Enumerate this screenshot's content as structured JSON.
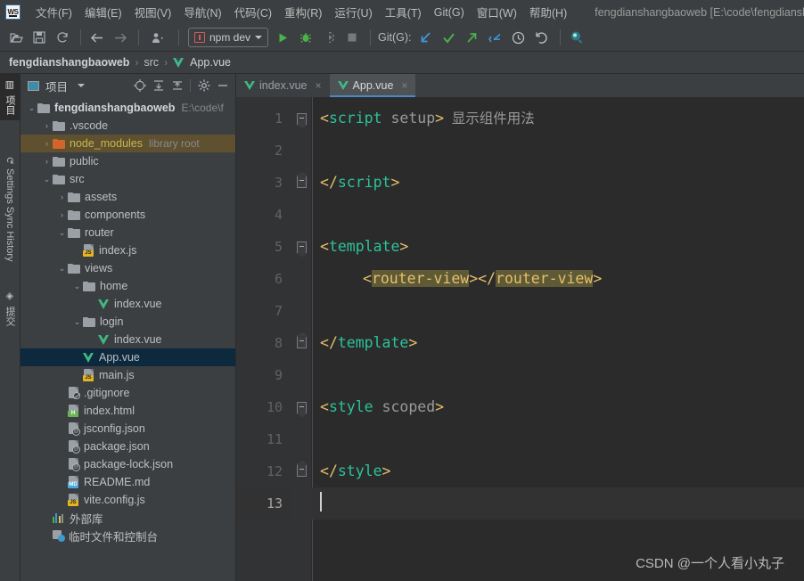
{
  "window": {
    "app_icon": "webstorm-logo-icon",
    "project_path_title": "fengdianshangbaoweb [E:\\code\\fengdianshan"
  },
  "menu": {
    "items": [
      {
        "label": "文件(F)",
        "name": "menu-file"
      },
      {
        "label": "编辑(E)",
        "name": "menu-edit"
      },
      {
        "label": "视图(V)",
        "name": "menu-view"
      },
      {
        "label": "导航(N)",
        "name": "menu-navigate"
      },
      {
        "label": "代码(C)",
        "name": "menu-code"
      },
      {
        "label": "重构(R)",
        "name": "menu-refactor"
      },
      {
        "label": "运行(U)",
        "name": "menu-run"
      },
      {
        "label": "工具(T)",
        "name": "menu-tools"
      },
      {
        "label": "Git(G)",
        "name": "menu-git"
      },
      {
        "label": "窗口(W)",
        "name": "menu-window"
      },
      {
        "label": "帮助(H)",
        "name": "menu-help"
      }
    ]
  },
  "toolbar": {
    "open_icon": "open-folder-icon",
    "save_icon": "save-icon",
    "sync_icon": "refresh-icon",
    "back_icon": "arrow-left-icon",
    "forward_icon": "arrow-right-icon",
    "profile_icon": "user-dropdown-icon",
    "run_config": "npm dev",
    "run_icon": "run-play-icon",
    "debug_icon": "debug-bug-icon",
    "coverage_icon": "run-coverage-icon",
    "stop_icon": "stop-square-icon",
    "git_label": "Git(G):",
    "update_icon": "git-update-arrow-icon",
    "commit_icon": "git-commit-check-icon",
    "push_icon": "git-push-arrow-icon",
    "pull_icon": "git-pull-icon",
    "history_icon": "clock-history-icon",
    "rollback_icon": "rollback-undo-icon",
    "search_icon": "search-everywhere-icon"
  },
  "breadcrumb": {
    "root": "fengdianshangbaoweb",
    "sep": "›",
    "mid": "src",
    "leaf": "App.vue",
    "leaf_icon": "vue-file-icon"
  },
  "rail": {
    "project_label": "项目",
    "project_icon": "project-panel-icon",
    "sync_label": "Settings Sync History",
    "sync_icon": "sync-history-icon",
    "commit_label": "提交",
    "commit_icon": "commit-icon"
  },
  "project_panel": {
    "title": "项目",
    "title_icon": "project-view-icon",
    "dropdown_icon": "chevron-down-icon",
    "actions": [
      {
        "name": "locate-file-icon",
        "glyph": "⊕"
      },
      {
        "name": "expand-all-icon",
        "glyph": "⤓"
      },
      {
        "name": "collapse-all-icon",
        "glyph": "⤒"
      },
      {
        "name": "settings-gear-icon",
        "glyph": "⚙"
      },
      {
        "name": "hide-panel-icon",
        "glyph": "—"
      }
    ],
    "tree": [
      {
        "label": "fengdianshangbaoweb",
        "hint": "E:\\code\\f",
        "indent": 0,
        "arrow": "v",
        "icon": "folder",
        "style": "bold"
      },
      {
        "label": ".vscode",
        "hint": "",
        "indent": 1,
        "arrow": ">",
        "icon": "folder"
      },
      {
        "label": "node_modules",
        "hint": "library root",
        "indent": 1,
        "arrow": ">",
        "icon": "folder-orange",
        "style": "module",
        "state": "highlighted"
      },
      {
        "label": "public",
        "hint": "",
        "indent": 1,
        "arrow": ">",
        "icon": "folder"
      },
      {
        "label": "src",
        "hint": "",
        "indent": 1,
        "arrow": "v",
        "icon": "folder"
      },
      {
        "label": "assets",
        "hint": "",
        "indent": 2,
        "arrow": ">",
        "icon": "folder"
      },
      {
        "label": "components",
        "hint": "",
        "indent": 2,
        "arrow": ">",
        "icon": "folder"
      },
      {
        "label": "router",
        "hint": "",
        "indent": 2,
        "arrow": "v",
        "icon": "folder"
      },
      {
        "label": "index.js",
        "hint": "",
        "indent": 3,
        "arrow": "",
        "icon": "js"
      },
      {
        "label": "views",
        "hint": "",
        "indent": 2,
        "arrow": "v",
        "icon": "folder"
      },
      {
        "label": "home",
        "hint": "",
        "indent": 3,
        "arrow": "v",
        "icon": "folder"
      },
      {
        "label": "index.vue",
        "hint": "",
        "indent": 4,
        "arrow": "",
        "icon": "vue"
      },
      {
        "label": "login",
        "hint": "",
        "indent": 3,
        "arrow": "v",
        "icon": "folder"
      },
      {
        "label": "index.vue",
        "hint": "",
        "indent": 4,
        "arrow": "",
        "icon": "vue"
      },
      {
        "label": "App.vue",
        "hint": "",
        "indent": 3,
        "arrow": "",
        "icon": "vue",
        "state": "selected"
      },
      {
        "label": "main.js",
        "hint": "",
        "indent": 3,
        "arrow": "",
        "icon": "js"
      },
      {
        "label": ".gitignore",
        "hint": "",
        "indent": 2,
        "arrow": "",
        "icon": "gitignore"
      },
      {
        "label": "index.html",
        "hint": "",
        "indent": 2,
        "arrow": "",
        "icon": "html"
      },
      {
        "label": "jsconfig.json",
        "hint": "",
        "indent": 2,
        "arrow": "",
        "icon": "json"
      },
      {
        "label": "package.json",
        "hint": "",
        "indent": 2,
        "arrow": "",
        "icon": "json"
      },
      {
        "label": "package-lock.json",
        "hint": "",
        "indent": 2,
        "arrow": "",
        "icon": "json"
      },
      {
        "label": "README.md",
        "hint": "",
        "indent": 2,
        "arrow": "",
        "icon": "md"
      },
      {
        "label": "vite.config.js",
        "hint": "",
        "indent": 2,
        "arrow": "",
        "icon": "js"
      },
      {
        "label": "外部库",
        "hint": "",
        "indent": 1,
        "arrow": "",
        "icon": "library"
      },
      {
        "label": "临时文件和控制台",
        "hint": "",
        "indent": 1,
        "arrow": "",
        "icon": "scratch"
      }
    ]
  },
  "editor": {
    "tabs": [
      {
        "label": "index.vue",
        "icon": "vue-file-icon",
        "active": false,
        "close": "×"
      },
      {
        "label": "App.vue",
        "icon": "vue-file-icon",
        "active": true,
        "close": "×"
      }
    ],
    "line_numbers": [
      "1",
      "2",
      "3",
      "4",
      "5",
      "6",
      "7",
      "8",
      "9",
      "10",
      "11",
      "12",
      "13"
    ],
    "current_line": 13,
    "lines": [
      {
        "n": 1,
        "fold": "open",
        "tokens": [
          {
            "t": "<",
            "c": "brk"
          },
          {
            "t": "script",
            "c": "tag"
          },
          {
            "t": " setup",
            "c": "attr"
          },
          {
            "t": ">",
            "c": "brk"
          },
          {
            "t": "  显示组件用法",
            "c": "cn"
          }
        ]
      },
      {
        "n": 2,
        "fold": "",
        "tokens": []
      },
      {
        "n": 3,
        "fold": "close",
        "tokens": [
          {
            "t": "<",
            "c": "brk"
          },
          {
            "t": "/",
            "c": "brk"
          },
          {
            "t": "script",
            "c": "tag"
          },
          {
            "t": ">",
            "c": "brk"
          }
        ]
      },
      {
        "n": 4,
        "fold": "",
        "tokens": []
      },
      {
        "n": 5,
        "fold": "open",
        "tokens": [
          {
            "t": "<",
            "c": "brk"
          },
          {
            "t": "template",
            "c": "tag"
          },
          {
            "t": ">",
            "c": "brk"
          }
        ]
      },
      {
        "n": 6,
        "fold": "",
        "indentpx": 48,
        "tokens": [
          {
            "t": "<",
            "c": "custom"
          },
          {
            "t": "router-view",
            "c": "custom",
            "hl": true
          },
          {
            "t": ">",
            "c": "custom"
          },
          {
            "t": "</",
            "c": "custom"
          },
          {
            "t": "router-view",
            "c": "custom",
            "hl": true
          },
          {
            "t": ">",
            "c": "custom"
          }
        ]
      },
      {
        "n": 7,
        "fold": "",
        "tokens": []
      },
      {
        "n": 8,
        "fold": "close",
        "tokens": [
          {
            "t": "<",
            "c": "brk"
          },
          {
            "t": "/",
            "c": "brk"
          },
          {
            "t": "template",
            "c": "tag"
          },
          {
            "t": ">",
            "c": "brk"
          }
        ]
      },
      {
        "n": 9,
        "fold": "",
        "tokens": []
      },
      {
        "n": 10,
        "fold": "open",
        "tokens": [
          {
            "t": "<",
            "c": "brk"
          },
          {
            "t": "style",
            "c": "tag"
          },
          {
            "t": " scoped",
            "c": "attr"
          },
          {
            "t": ">",
            "c": "brk"
          }
        ]
      },
      {
        "n": 11,
        "fold": "",
        "tokens": []
      },
      {
        "n": 12,
        "fold": "close",
        "tokens": [
          {
            "t": "<",
            "c": "brk"
          },
          {
            "t": "/",
            "c": "brk"
          },
          {
            "t": "style",
            "c": "tag"
          },
          {
            "t": ">",
            "c": "brk"
          }
        ]
      },
      {
        "n": 13,
        "fold": "",
        "cursor": true,
        "tokens": []
      }
    ],
    "watermark": "CSDN @一个人看小丸子"
  },
  "colors": {
    "accent": "#4a88c7",
    "vue_green": "#41b883",
    "tag": "#2cc29b",
    "bracket": "#e8bf6a",
    "selection": "#0d293e",
    "module_highlight": "#5f5030",
    "occurrence": "#5e5a36"
  }
}
